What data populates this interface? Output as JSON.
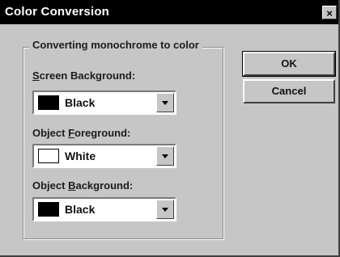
{
  "window": {
    "title": "Color Conversion",
    "close_glyph": "×"
  },
  "group": {
    "legend": "Converting monochrome to color"
  },
  "fields": [
    {
      "label_pre": "",
      "label_key": "S",
      "label_post": "creen Background:",
      "value": "Black",
      "swatch_color": "#000000"
    },
    {
      "label_pre": "Object ",
      "label_key": "F",
      "label_post": "oreground:",
      "value": "White",
      "swatch_color": "#ffffff"
    },
    {
      "label_pre": "Object ",
      "label_key": "B",
      "label_post": "ackground:",
      "value": "Black",
      "swatch_color": "#000000"
    }
  ],
  "buttons": {
    "ok": "OK",
    "cancel": "Cancel"
  },
  "colors": {
    "title_bar": "#000000",
    "dialog_face": "#c6c6c6"
  }
}
